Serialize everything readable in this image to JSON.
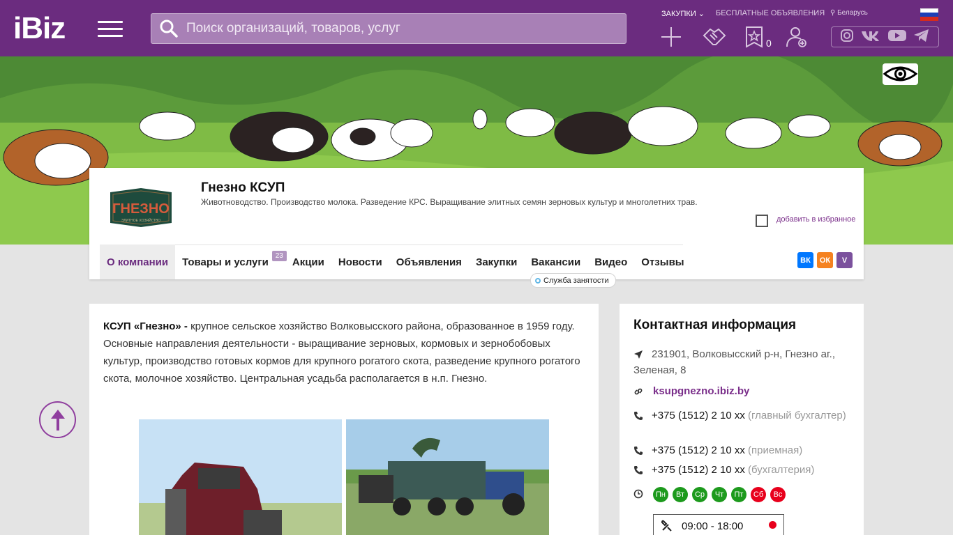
{
  "header": {
    "logo": "iBiz",
    "search_placeholder": "Поиск организаций, товаров, услуг",
    "links": {
      "zakupki": "ЗАКУПКИ",
      "free_ads": "БЕСПЛАТНЫЕ ОБЪЯВЛЕНИЯ",
      "region": "Беларусь"
    },
    "favorites_count": "0",
    "social_icons": [
      "instagram-icon",
      "vk-icon",
      "youtube-icon",
      "telegram-icon"
    ]
  },
  "company": {
    "title": "Гнезно КСУП",
    "description": "Животноводство. Производство молока. Разведение КРС. Выращивание элитных семян зерновых культур и многолетних трав.",
    "add_favorite": "добавить в избранное",
    "logo_text": "ГНЕЗНО",
    "logo_subtext": "ЭЛИТНОЕ ХОЗЯЙСТВО"
  },
  "nav": {
    "items": [
      {
        "label": "О компании"
      },
      {
        "label": "Товары и услуги",
        "badge": "23"
      },
      {
        "label": "Акции"
      },
      {
        "label": "Новости"
      },
      {
        "label": "Объявления"
      },
      {
        "label": "Закупки"
      },
      {
        "label": "Вакансии"
      },
      {
        "label": "Видео"
      },
      {
        "label": "Отзывы"
      }
    ],
    "tooltip": "Служба занятости",
    "share": {
      "vk": "ВК",
      "ok": "ОК",
      "viber": "V"
    }
  },
  "about": {
    "lead": "КСУП «Гнезно» -",
    "text": " крупное сельское хозяйство Волковысского района, образованное в 1959 году. Основные направления деятельности - выращивание зерновых, кормовых и зернобобовых культур, производство готовых кормов для крупного рогатого скота, разведение крупного рогатого скота, молочное хозяйство. Центральная усадьба располагается в н.п. Гнезно."
  },
  "contacts": {
    "title": "Контактная информация",
    "address": "231901, Волковысский р-н, Гнезно аг., Зеленая, 8",
    "website": "ksupgnezno.ibiz.by",
    "phones": [
      {
        "number": "+375 (1512) 2 10 xx",
        "note": "(главный бухгалтер)"
      },
      {
        "number": "+375 (1512) 2 10 xx",
        "note": "(приемная)"
      },
      {
        "number": "+375 (1512) 2 10 xx",
        "note": "(бухгалтерия)"
      }
    ],
    "days": [
      {
        "label": "Пн",
        "color": "#1d9a1d"
      },
      {
        "label": "Вт",
        "color": "#1d9a1d"
      },
      {
        "label": "Ср",
        "color": "#1d9a1d"
      },
      {
        "label": "Чт",
        "color": "#1d9a1d"
      },
      {
        "label": "Пт",
        "color": "#1d9a1d"
      },
      {
        "label": "Сб",
        "color": "#e8001c"
      },
      {
        "label": "Вс",
        "color": "#e8001c"
      }
    ],
    "hours": "09:00 - 18:00"
  },
  "colors": {
    "brand": "#6b2c7f",
    "link": "#7a2e8a",
    "open": "#1d9a1d",
    "closed": "#e8001c"
  }
}
